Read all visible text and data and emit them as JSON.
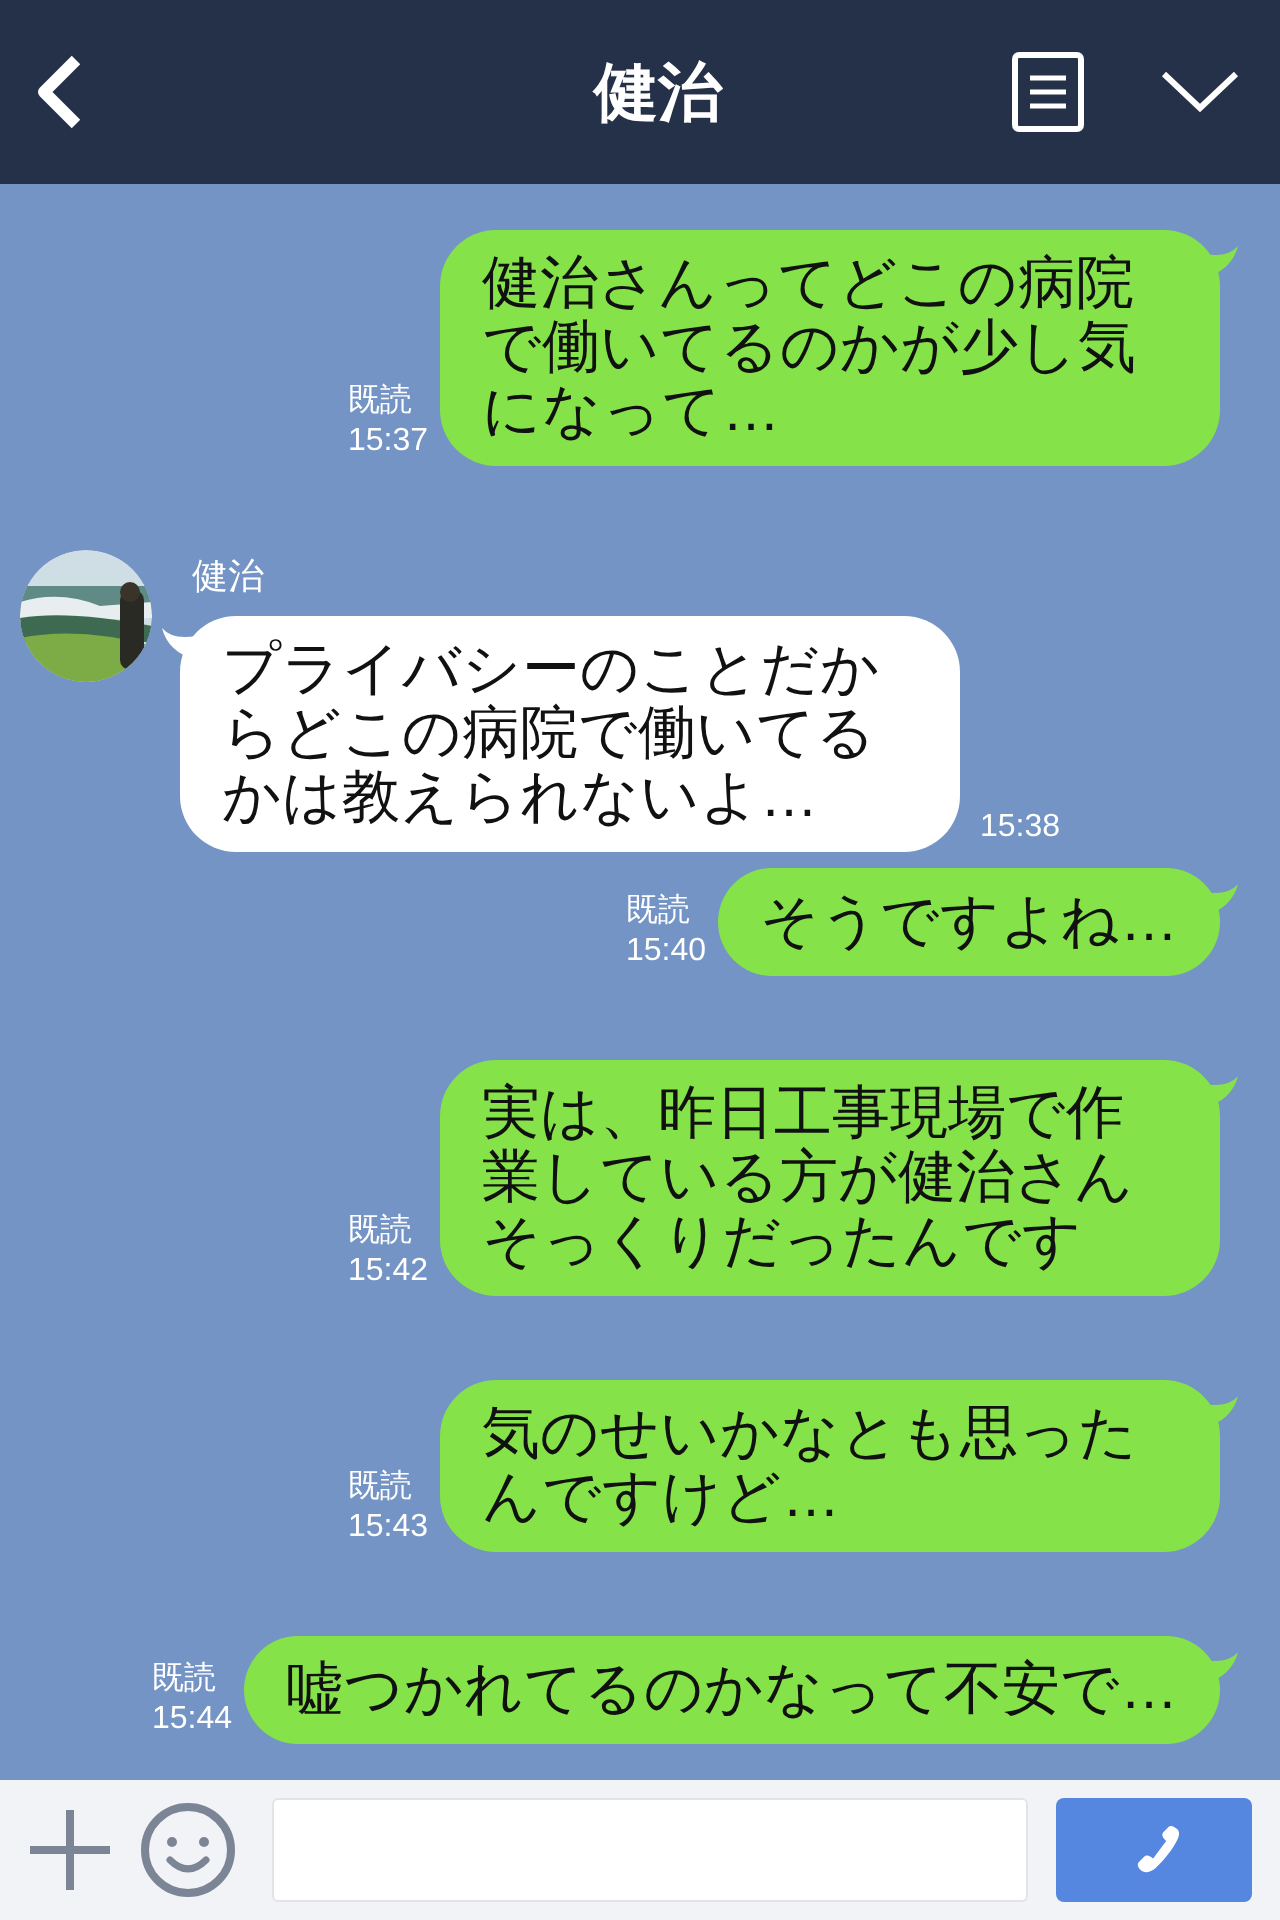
{
  "header": {
    "title": "健治"
  },
  "messages": [
    {
      "kind": "sent",
      "text": "健治さんってどこの病院で働いてるのかが少し気になって…",
      "read": "既読",
      "time": "15:37"
    },
    {
      "kind": "received",
      "sender": "健治",
      "text": "プライバシーのことだからどこの病院で働いてるかは教えられないよ…",
      "time": "15:38"
    },
    {
      "kind": "sent",
      "text": "そうですよね…",
      "read": "既読",
      "time": "15:40"
    },
    {
      "kind": "sent",
      "text": "実は、昨日工事現場で作業している方が健治さんそっくりだったんです",
      "read": "既読",
      "time": "15:42"
    },
    {
      "kind": "sent",
      "text": "気のせいかなとも思ったんですけど…",
      "read": "既読",
      "time": "15:43"
    },
    {
      "kind": "sent",
      "text": "嘘つかれてるのかなって不安で…",
      "read": "既読",
      "time": "15:44"
    }
  ]
}
